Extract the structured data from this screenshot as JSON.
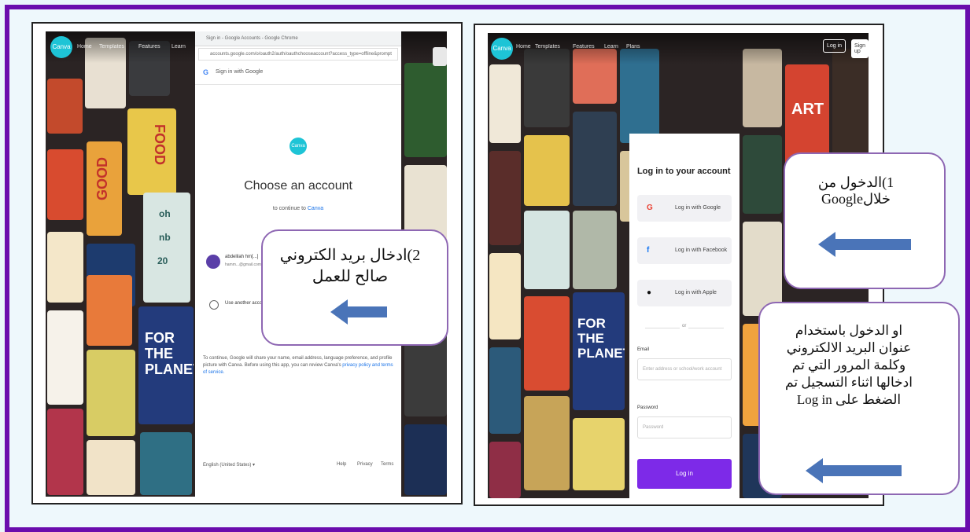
{
  "left_panel": {
    "browser_title": "Sign in - Google Accounts - Google Chrome",
    "browser_url": "accounts.google.com/o/oauth2/auth/oauthchooseaccount?access_type=offline&prompt",
    "sign_in_header": "Sign in with Google",
    "logo_text": "Canva",
    "choose_title": "Choose an account",
    "continue_prefix": "to continue to ",
    "continue_app": "Canva",
    "account_name": "abdelilah hm[...]",
    "account_email": "hamm...@gmail.com",
    "use_another": "Use another account",
    "disclaimer": "To continue, Google will share your name, email address, language preference, and profile picture with Canva. Before using this app, you can review Canva's",
    "disclaimer_links": "privacy policy and terms of service.",
    "footer_lang": "English (United States)",
    "footer_help": "Help",
    "footer_privacy": "Privacy",
    "footer_terms": "Terms",
    "nav_home": "Home",
    "nav_templates": "Templates",
    "nav_features": "Features",
    "nav_learn": "Learn",
    "callout_text_line1": "2)ادخال بريد الكتروني",
    "callout_text_line2": "صالح للعمل"
  },
  "right_panel": {
    "logo_text": "Canva",
    "nav_home": "Home",
    "nav_templates": "Templates",
    "nav_features": "Features",
    "nav_learn": "Learn",
    "nav_plans": "Plans",
    "login_top": "Log in",
    "signup_top": "Sign up",
    "card_title": "Log in to your account",
    "google_btn": "Log in with Google",
    "facebook_btn": "Log in with Facebook",
    "apple_btn": "Log in with Apple",
    "or_text": "or",
    "email_label": "Email",
    "email_placeholder": "Enter address or school/work account",
    "password_label": "Password",
    "password_placeholder": "Password",
    "login_btn": "Log in",
    "callout1_line1": "1)الدخول من",
    "callout1_line2": "خلالGoogle",
    "callout2_line1": "او الدخول باستخدام",
    "callout2_line2": "عنوان البريد الالكتروني",
    "callout2_line3": "وكلمة المرور التي تم",
    "callout2_line4": "ادخالها اثناء التسجيل تم",
    "callout2_line5": "الضغط على Log in"
  },
  "tiles": {
    "food": "FOOD",
    "good": "GOOD",
    "for_the_planet": "FOR THE PLANET",
    "art": "ART",
    "oh": "oh",
    "nb": "nb",
    "zo": "20"
  },
  "colors": {
    "frame": "#6a0dad",
    "callout_border": "#8e67b3",
    "arrow": "#4a74b8",
    "canva_teal": "#1ec4d6",
    "login_purple": "#7d2ae8"
  }
}
